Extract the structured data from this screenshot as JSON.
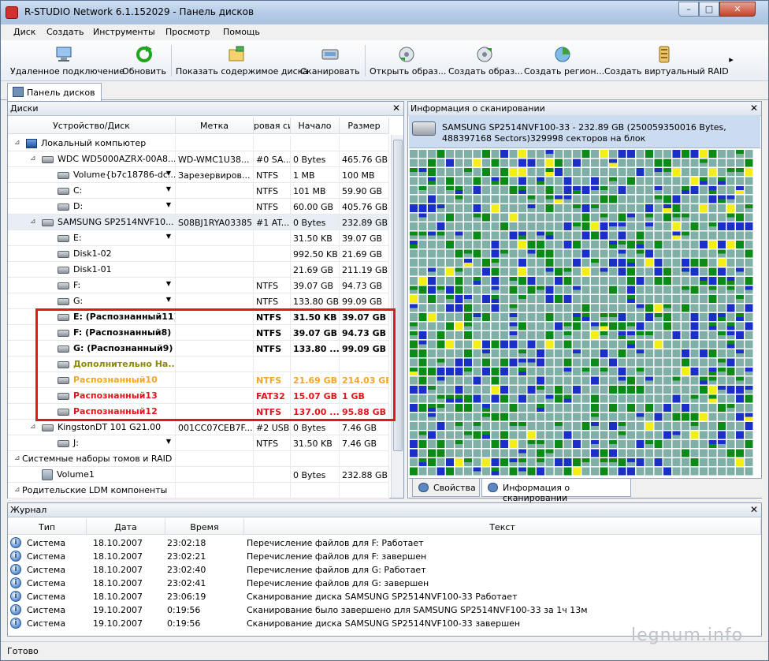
{
  "window": {
    "title": "R-STUDIO Network 6.1.152029 - Панель дисков",
    "min": "–",
    "max": "□",
    "close": "✕"
  },
  "menu": [
    "Диск",
    "Создать",
    "Инструменты",
    "Просмотр",
    "Помощь"
  ],
  "toolbar": [
    {
      "label": "Удаленное подключение",
      "icon": "remote-connection-icon"
    },
    {
      "label": "Обновить",
      "icon": "refresh-icon"
    },
    {
      "label": "Показать содержимое диска",
      "icon": "show-disk-contents-icon"
    },
    {
      "label": "Сканировать",
      "icon": "scan-icon"
    },
    {
      "label": "Открыть образ...",
      "icon": "open-image-icon"
    },
    {
      "label": "Создать образ...",
      "icon": "create-image-icon"
    },
    {
      "label": "Создать регион...",
      "icon": "create-region-icon"
    },
    {
      "label": "Создать виртуальный RAID",
      "icon": "virtual-raid-icon"
    }
  ],
  "toolbar_more": "▸",
  "doc_tab": "Панель дисков",
  "disks_panel": {
    "title": "Диски",
    "close": "✕",
    "columns": [
      "Устройство/Диск",
      "Метка",
      "ровая си",
      "Начало",
      "Размер"
    ],
    "rows": [
      {
        "name": "Локальный компьютер",
        "label": "",
        "fs": "",
        "start": "",
        "size": "",
        "icon": "computer",
        "expander": "⊿",
        "level": 0
      },
      {
        "name": "WDC WD5000AZRX-00A8...",
        "label": "WD-WMC1U38...",
        "fs": "#0 SA...",
        "start": "0 Bytes",
        "size": "465.76 GB",
        "icon": "hdd",
        "expander": "⊿",
        "level": 1
      },
      {
        "name": "Volume{b7c18786-dc...",
        "label": "Зарезервиров...",
        "fs": "NTFS",
        "start": "1 MB",
        "size": "100 MB",
        "icon": "hdd",
        "dropdown": true,
        "level": 2
      },
      {
        "name": "C:",
        "label": "",
        "fs": "NTFS",
        "start": "101 MB",
        "size": "59.90 GB",
        "icon": "hdd",
        "dropdown": true,
        "level": 2
      },
      {
        "name": "D:",
        "label": "",
        "fs": "NTFS",
        "start": "60.00 GB",
        "size": "405.76 GB",
        "icon": "hdd",
        "dropdown": true,
        "level": 2
      },
      {
        "name": "SAMSUNG SP2514NVF10...",
        "label": "S08BJ1RYA03385",
        "fs": "#1 AT...",
        "start": "0 Bytes",
        "size": "232.89 GB",
        "icon": "hdd",
        "expander": "⊿",
        "level": 1,
        "selected": true
      },
      {
        "name": "E:",
        "label": "",
        "fs": "",
        "start": "31.50 KB",
        "size": "39.07 GB",
        "icon": "hdd",
        "dropdown": true,
        "level": 2
      },
      {
        "name": "Disk1-02",
        "label": "",
        "fs": "",
        "start": "992.50 KB",
        "size": "21.69 GB",
        "icon": "hdd",
        "level": 2
      },
      {
        "name": "Disk1-01",
        "label": "",
        "fs": "",
        "start": "21.69 GB",
        "size": "211.19 GB",
        "icon": "hdd",
        "level": 2
      },
      {
        "name": "F:",
        "label": "",
        "fs": "NTFS",
        "start": "39.07 GB",
        "size": "94.73 GB",
        "icon": "hdd",
        "dropdown": true,
        "level": 2
      },
      {
        "name": "G:",
        "label": "",
        "fs": "NTFS",
        "start": "133.80 GB",
        "size": "99.09 GB",
        "icon": "hdd",
        "dropdown": true,
        "level": 2
      },
      {
        "name": "E: (Распознанный11)",
        "label": "",
        "fs": "NTFS",
        "start": "31.50 KB",
        "size": "39.07 GB",
        "icon": "hdd",
        "level": 2,
        "style": "bold"
      },
      {
        "name": "F: (Распознанный8)",
        "label": "",
        "fs": "NTFS",
        "start": "39.07 GB",
        "size": "94.73 GB",
        "icon": "hdd",
        "level": 2,
        "style": "bold"
      },
      {
        "name": "G: (Распознанный9)",
        "label": "",
        "fs": "NTFS",
        "start": "133.80 ...",
        "size": "99.09 GB",
        "icon": "hdd",
        "level": 2,
        "style": "bold"
      },
      {
        "name": "Дополнительно На...",
        "label": "",
        "fs": "",
        "start": "",
        "size": "",
        "icon": "hdd",
        "level": 2,
        "style": "olive"
      },
      {
        "name": "Распознанный10",
        "label": "",
        "fs": "NTFS",
        "start": "21.69 GB",
        "size": "214.03 GB",
        "icon": "hdd",
        "level": 2,
        "style": "orange"
      },
      {
        "name": "Распознанный13",
        "label": "",
        "fs": "FAT32",
        "start": "15.07 GB",
        "size": "1 GB",
        "icon": "hdd",
        "level": 2,
        "style": "red"
      },
      {
        "name": "Распознанный12",
        "label": "",
        "fs": "NTFS",
        "start": "137.00 ...",
        "size": "95.88 GB",
        "icon": "hdd",
        "level": 2,
        "style": "red"
      },
      {
        "name": "KingstonDT 101 G21.00",
        "label": "001CC07CEB7F...",
        "fs": "#2 USB",
        "start": "0 Bytes",
        "size": "7.46 GB",
        "icon": "hdd",
        "expander": "⊿",
        "level": 1
      },
      {
        "name": "J:",
        "label": "",
        "fs": "NTFS",
        "start": "31.50 KB",
        "size": "7.46 GB",
        "icon": "hdd",
        "dropdown": true,
        "level": 2
      },
      {
        "name": "Системные наборы томов и RAID",
        "label": "",
        "fs": "",
        "start": "",
        "size": "",
        "icon": "none",
        "expander": "⊿",
        "level": 0
      },
      {
        "name": "Volume1",
        "label": "",
        "fs": "",
        "start": "0 Bytes",
        "size": "232.88 GB",
        "icon": "volume",
        "level": 1
      },
      {
        "name": "Родительские LDM компоненты",
        "label": "",
        "fs": "",
        "start": "",
        "size": "",
        "icon": "none",
        "expander": "⊿",
        "level": 0
      }
    ]
  },
  "scan_panel": {
    "title": "Информация о сканировании",
    "close": "✕",
    "header_text": "SAMSUNG SP2514NVF100-33 - 232.89 GB (250059350016 Bytes, 488397168 Sectors)329998 секторов на блок",
    "colors": {
      "teal": "#7fafa6",
      "blue": "#1a2fc8",
      "green": "#0c8a17",
      "yellow": "#f3ee17",
      "grid": "#ffffff"
    },
    "tabs": [
      "Свойства",
      "Информация о сканировании"
    ]
  },
  "journal": {
    "title": "Журнал",
    "close": "✕",
    "columns": [
      "Тип",
      "Дата",
      "Время",
      "Текст"
    ],
    "rows": [
      {
        "type": "Система",
        "date": "18.10.2007",
        "time": "23:02:18",
        "text": "Перечисление файлов для F: Работает"
      },
      {
        "type": "Система",
        "date": "18.10.2007",
        "time": "23:02:21",
        "text": "Перечисление файлов для F: завершен"
      },
      {
        "type": "Система",
        "date": "18.10.2007",
        "time": "23:02:40",
        "text": "Перечисление файлов для G: Работает"
      },
      {
        "type": "Система",
        "date": "18.10.2007",
        "time": "23:02:41",
        "text": "Перечисление файлов для G: завершен"
      },
      {
        "type": "Система",
        "date": "18.10.2007",
        "time": "23:06:19",
        "text": "Сканирование диска SAMSUNG SP2514NVF100-33 Работает"
      },
      {
        "type": "Система",
        "date": "19.10.2007",
        "time": "0:19:56",
        "text": "Сканирование было завершено для SAMSUNG SP2514NVF100-33 за 1ч 13м"
      },
      {
        "type": "Система",
        "date": "19.10.2007",
        "time": "0:19:56",
        "text": "Сканирование диска SAMSUNG SP2514NVF100-33 завершен"
      }
    ]
  },
  "status": "Готово",
  "watermark": "legnum.info"
}
